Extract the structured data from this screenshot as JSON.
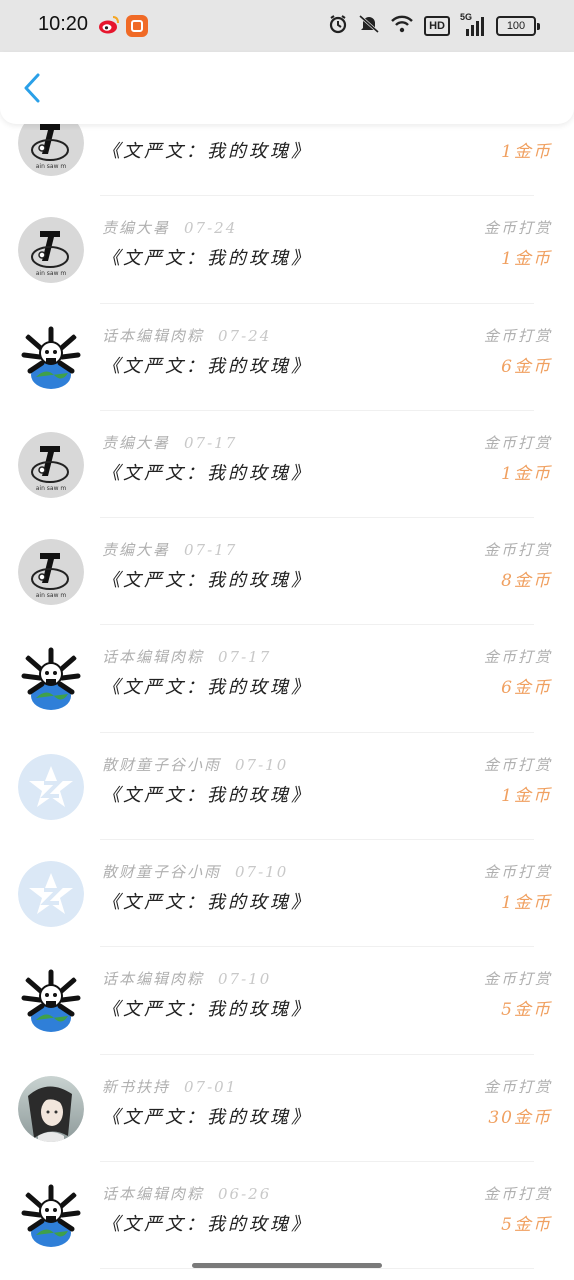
{
  "status_bar": {
    "time": "10:20",
    "battery": "100",
    "hd": "HD",
    "network": "5G"
  },
  "header": {
    "back_icon": "chevron-left-icon"
  },
  "colors": {
    "accent": "#2aa0e8",
    "amount": "#f0a060",
    "muted": "#b0b0b0"
  },
  "list": [
    {
      "avatar": "editor",
      "user": "",
      "date": "",
      "title": "《文严文：我的玫瑰》",
      "type": "",
      "amount": "1金币"
    },
    {
      "avatar": "editor",
      "user": "责编大暑",
      "date": "07-24",
      "title": "《文严文：我的玫瑰》",
      "type": "金币打赏",
      "amount": "1金币"
    },
    {
      "avatar": "skull",
      "user": "话本编辑肉粽",
      "date": "07-24",
      "title": "《文严文：我的玫瑰》",
      "type": "金币打赏",
      "amount": "6金币"
    },
    {
      "avatar": "editor",
      "user": "责编大暑",
      "date": "07-17",
      "title": "《文严文：我的玫瑰》",
      "type": "金币打赏",
      "amount": "1金币"
    },
    {
      "avatar": "editor",
      "user": "责编大暑",
      "date": "07-17",
      "title": "《文严文：我的玫瑰》",
      "type": "金币打赏",
      "amount": "8金币"
    },
    {
      "avatar": "skull",
      "user": "话本编辑肉粽",
      "date": "07-17",
      "title": "《文严文：我的玫瑰》",
      "type": "金币打赏",
      "amount": "6金币"
    },
    {
      "avatar": "zlogo",
      "user": "散财童子谷小雨",
      "date": "07-10",
      "title": "《文严文：我的玫瑰》",
      "type": "金币打赏",
      "amount": "1金币"
    },
    {
      "avatar": "zlogo",
      "user": "散财童子谷小雨",
      "date": "07-10",
      "title": "《文严文：我的玫瑰》",
      "type": "金币打赏",
      "amount": "1金币"
    },
    {
      "avatar": "skull",
      "user": "话本编辑肉粽",
      "date": "07-10",
      "title": "《文严文：我的玫瑰》",
      "type": "金币打赏",
      "amount": "5金币"
    },
    {
      "avatar": "anime",
      "user": "新书扶持",
      "date": "07-01",
      "title": "《文严文：我的玫瑰》",
      "type": "金币打赏",
      "amount": "30金币"
    },
    {
      "avatar": "skull",
      "user": "话本编辑肉粽",
      "date": "06-26",
      "title": "《文严文：我的玫瑰》",
      "type": "金币打赏",
      "amount": "5金币"
    }
  ]
}
